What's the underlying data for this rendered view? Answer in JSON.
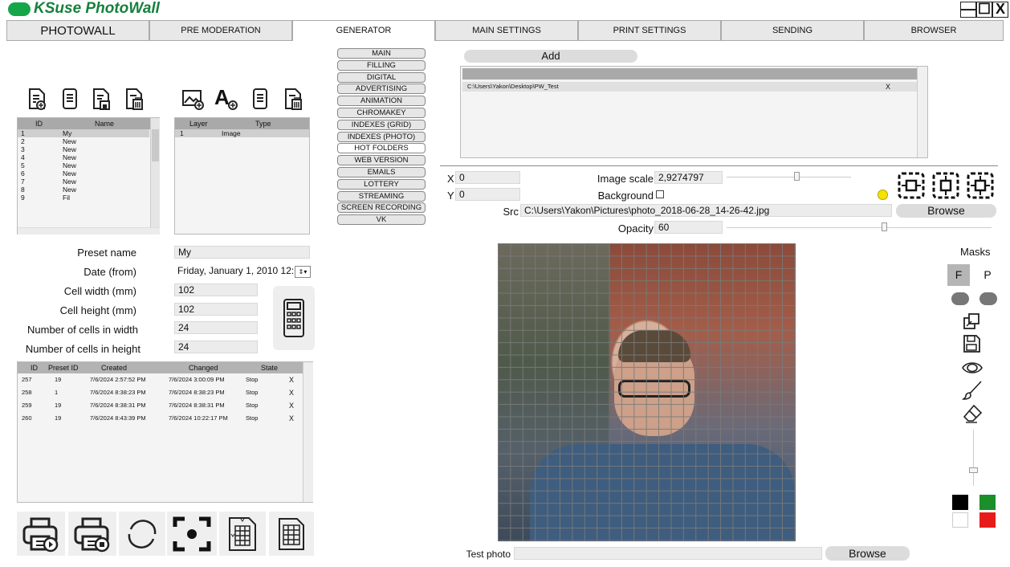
{
  "app": {
    "title": "KSuse PhotoWall",
    "minimize": "—",
    "maximize": "☐",
    "close": "X"
  },
  "tabs": [
    "PHOTOWALL",
    "PRE MODERATION",
    "GENERATOR",
    "MAIN SETTINGS",
    "PRINT SETTINGS",
    "SENDING",
    "BROWSER"
  ],
  "active_tab": "GENERATOR",
  "preset_list": {
    "headers": [
      "ID",
      "Name"
    ],
    "rows": [
      {
        "id": "1",
        "name": "My",
        "selected": true
      },
      {
        "id": "2",
        "name": "New"
      },
      {
        "id": "3",
        "name": "New"
      },
      {
        "id": "4",
        "name": "New"
      },
      {
        "id": "5",
        "name": "New"
      },
      {
        "id": "6",
        "name": "New"
      },
      {
        "id": "7",
        "name": "New"
      },
      {
        "id": "8",
        "name": "New"
      },
      {
        "id": "9",
        "name": "Fil"
      }
    ]
  },
  "layer_list": {
    "headers": [
      "Layer",
      "Type"
    ],
    "rows": [
      {
        "layer": "1",
        "type": "Image"
      }
    ]
  },
  "form": {
    "preset_name_label": "Preset name",
    "preset_name": "My",
    "date_label": "Date (from)",
    "date": "Friday, January 1, 2010 12:",
    "cell_width_label": "Cell width (mm)",
    "cell_width": "102",
    "cell_height_label": "Cell height (mm)",
    "cell_height": "102",
    "cells_w_label": "Number of cells in width",
    "cells_w": "24",
    "cells_h_label": "Number of cells in height",
    "cells_h": "24"
  },
  "jobs": {
    "headers": [
      "ID",
      "Preset ID",
      "Created",
      "Changed",
      "State"
    ],
    "rows": [
      {
        "id": "257",
        "preset": "19",
        "created": "7/6/2024 2:57:52 PM",
        "changed": "7/6/2024 3:00:09 PM",
        "state": "Stop"
      },
      {
        "id": "258",
        "preset": "1",
        "created": "7/6/2024 8:38:23 PM",
        "changed": "7/6/2024 8:38:23 PM",
        "state": "Stop"
      },
      {
        "id": "259",
        "preset": "19",
        "created": "7/6/2024 8:38:31 PM",
        "changed": "7/6/2024 8:38:31 PM",
        "state": "Stop"
      },
      {
        "id": "260",
        "preset": "19",
        "created": "7/6/2024 8:43:39 PM",
        "changed": "7/6/2024 10:22:17 PM",
        "state": "Stop"
      }
    ],
    "delete": "X"
  },
  "side_menu": [
    "MAIN",
    "FILLING",
    "DIGITAL",
    "ADVERTISING",
    "ANIMATION",
    "CHROMAKEY",
    "INDEXES (GRID)",
    "INDEXES (PHOTO)",
    "HOT FOLDERS",
    "WEB VERSION",
    "EMAILS",
    "LOTTERY",
    "STREAMING",
    "SCREEN RECORDING",
    "VK"
  ],
  "side_menu_highlight": "HOT FOLDERS",
  "hot_folders": {
    "add": "Add",
    "path": "C:\\Users\\Yakon\\Desktop\\PW_Test",
    "delete": "X"
  },
  "layer_props": {
    "x_label": "X",
    "x": "0",
    "y_label": "Y",
    "y": "0",
    "scale_label": "Image scale",
    "scale": "2,9274797",
    "background_label": "Background",
    "src_label": "Src",
    "src": "C:\\Users\\Yakon\\Pictures\\photo_2018-06-28_14-26-42.jpg",
    "browse": "Browse",
    "opacity_label": "Opacity",
    "opacity": "60"
  },
  "masks": {
    "label": "Masks",
    "f": "F",
    "p": "P"
  },
  "test_photo": {
    "label": "Test photo",
    "value": "",
    "browse": "Browse"
  },
  "colors": {
    "accent_green": "#16a64a",
    "title_green": "#15803d",
    "indicator_yellow": "#f5e300",
    "swatches": [
      "#000000",
      "#1a8f2a",
      "#ffffff",
      "#e81b1b"
    ]
  }
}
